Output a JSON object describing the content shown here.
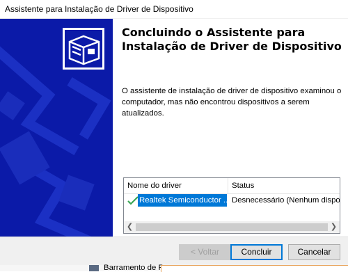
{
  "window": {
    "title": "Assistente para Instalação de Driver de Dispositivo"
  },
  "wizard": {
    "heading_line1": "Concluindo o Assistente para",
    "heading_line2": "Instalação de Driver de Dispositivo",
    "description": "O assistente de instalação de driver de dispositivo examinou o computador, mas não encontrou dispositivos a serem atualizados.",
    "banner_icon": "device-box-icon"
  },
  "driver_list": {
    "columns": [
      "Nome do driver",
      "Status"
    ],
    "rows": [
      {
        "icon": "checkmark-icon",
        "name": "Realtek Semiconductor ...",
        "status": "Desnecessário (Nenhum dispositi"
      }
    ]
  },
  "buttons": {
    "back": "< Voltar",
    "finish": "Concluir",
    "cancel": "Cancelar"
  },
  "background": {
    "item_text": "Barramento de P"
  },
  "colors": {
    "banner": "#0b1aa8",
    "selection": "#0078d7",
    "check": "#3aa655"
  }
}
